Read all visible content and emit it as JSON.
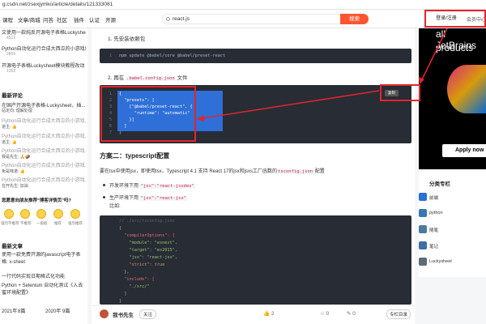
{
  "browser": {
    "url": "g.csdn.net/zsexjymko/article/details/121333081"
  },
  "nav": {
    "links": [
      "课程",
      "文章/商城",
      "问答",
      "社区",
      "插件",
      "认证",
      "开源"
    ],
    "search_query": "react.js",
    "search_button": "搜索",
    "login": "登录/注册",
    "messages": "会员中心"
  },
  "sidebar": {
    "items": [
      {
        "title": "文使用一款纯反开源电子表格Luckysheet",
        "meta": "4512"
      },
      {
        "title": "Python自动化运行合成大西瓜的小游戏场",
        "meta": "2805"
      },
      {
        "title": "开源电子表格Luckysheet模块教程改动",
        "meta": "1352"
      }
    ],
    "latest_comments_title": "最新评论",
    "comments": [
      {
        "title": "在国产开源电子表格-Luckysheet，插...",
        "meta": "站定向: 理解处理"
      },
      {
        "title": "Python自动化运行合成大西瓜的小游戏...",
        "meta": "道主: 👍"
      },
      {
        "title": "Python自动化运行合成大西瓜的小游戏...",
        "meta": "道主: 👍"
      },
      {
        "title": "Python自动化运行合成大西瓜的小游戏...",
        "meta": "我是先生: 🙏🥔"
      },
      {
        "title": "Python自动化运行合成大西瓜的小游戏...",
        "meta": "免是味诺: 👍"
      },
      {
        "title": "Python自动化运行合成大西瓜的小游戏...",
        "meta": "在开先生: 加油"
      }
    ],
    "survey_title": "您愿意向朋友推荐“博客详情页”吗?",
    "survey_options": [
      "强烈不推荐",
      "不推荐",
      "一般般",
      "推荐",
      "强烈推荐"
    ],
    "recent_title": "最新文章",
    "recent": [
      "使用一款免费开源的javascript电子表格: x-sheet",
      "一行代码实现日期格式化功能",
      "Python + Selenium 自动化测试《入去蜜环境配置》"
    ],
    "archive": [
      {
        "year": "2021年",
        "count": "8篇"
      },
      {
        "year": "2020年",
        "count": "9篇"
      }
    ]
  },
  "article": {
    "step1": "1. 先安装依赖包",
    "code1": "npm update @babel/core @babel/preset-react",
    "step2_prefix": "2. 再在",
    "step2_code": ".babel.config.json",
    "step2_suffix": "文件",
    "code2_lines": [
      "{",
      "  \"presets\": [",
      "    [\"@babel/preset-react\", {",
      "      \"runtime\": \"automatic\"",
      "    }]",
      "  ]",
      "}"
    ],
    "copy_label": "复制",
    "section2_title": "方案二：typescript配置",
    "section2_para_prefix": "要在tsx中使用jsx，即使用tsx，Typescript 4.1 支持 React 17的jsx和jsxs工厂函数的",
    "section2_para_code": "tsconfig.json",
    "section2_para_suffix": "配置",
    "bullet1_prefix": "开发环境下用",
    "bullet1_code1": "\"jsx\":\"react-jsxdev\"",
    "bullet2_prefix": "生产环境下用",
    "bullet2_code1": "\"jsx\":\"react-jsx\"",
    "bullet2_suffix": "比如:",
    "code3_lines": [
      "// ./src/tsconfig.json",
      "{",
      "  \"compilerOptions\": {",
      "    \"module\": \"esnext\",",
      "    \"target\": \"es2015\",",
      "    \"jsx\": \"react-jsx\",",
      "    \"strict\": true",
      "  },",
      "  \"include\": [",
      "    \"./src/\"",
      "  ]",
      "}"
    ]
  },
  "bottom_bar": {
    "author": "我书先生",
    "follow": "关注",
    "likes": "2",
    "stars": "0",
    "comments": "0",
    "collect_label": "专栏目录"
  },
  "ad": {
    "line1": "all JetBrains",
    "line2": "products",
    "apply": "Apply now"
  },
  "categories": {
    "title": "分类专栏",
    "items": [
      "前端",
      "python",
      "随笔",
      "笔记",
      "Luckysheet"
    ]
  }
}
